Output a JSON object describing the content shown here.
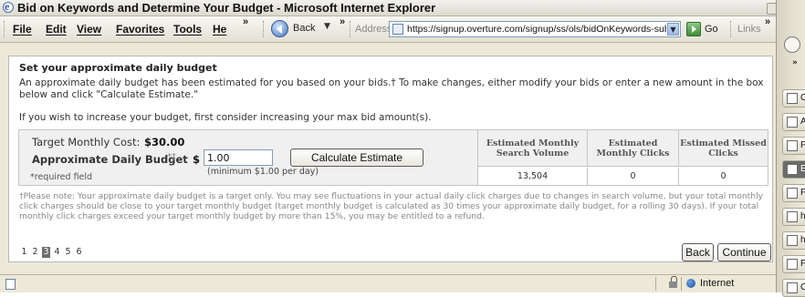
{
  "window": {
    "title": "Bid on Keywords and Determine Your Budget - Microsoft Internet Explorer"
  },
  "menu": [
    "File",
    "Edit",
    "View",
    "Favorites",
    "Tools",
    "He"
  ],
  "toolbar": {
    "back_label": "Back",
    "address_label": "Address",
    "url": "https://signup.overture.com/signup/ss/ols/bidOnKeywords-submit.",
    "go_label": "Go",
    "links_label": "Links"
  },
  "page": {
    "heading": "Set your approximate daily budget",
    "intro": "An approximate daily budget has been estimated for you based on your bids.† To make changes, either modify your bids or enter a new amount in the box below and click \"Calculate Estimate.\"",
    "increase_hint": "If you wish to increase your budget, first consider increasing your max bid amount(s).",
    "target_monthly_cost_label": "Target Monthly Cost:",
    "target_monthly_cost_value": "$30.00",
    "daily_budget_label": "Approximate Daily Budget",
    "daily_budget_required_mark": "*†",
    "currency_symbol": "$",
    "daily_budget_value": "1.00",
    "calculate_label": "Calculate Estimate",
    "minimum_note": "(minimum $1.00 per day)",
    "required_note": "*required field",
    "stats": {
      "headers": [
        "Estimated Monthly Search Volume",
        "Estimated Monthly Clicks",
        "Estimated Missed Clicks"
      ],
      "values": [
        "13,504",
        "0",
        "0"
      ]
    },
    "footnote": "†Please note: Your approximate daily budget is a target only. You may see fluctuations in your actual daily click charges due to changes in search volume, but your total monthly click charges should be close to your target monthly budget (target monthly budget is calculated as 30 times your approximate daily budget, for a rolling 30 days). If your total monthly click charges exceed your target monthly budget by more than 15%, you may be entitled to a refund.",
    "pages": [
      "1",
      "2",
      "3",
      "4",
      "5",
      "6"
    ],
    "current_page": "3",
    "back_button": "Back",
    "continue_button": "Continue"
  },
  "status": {
    "zone": "Internet"
  },
  "side_panel": {
    "items": [
      "C",
      "A",
      "F",
      "E",
      "F",
      "h",
      "h",
      "F",
      "C"
    ],
    "active_index": 3
  }
}
